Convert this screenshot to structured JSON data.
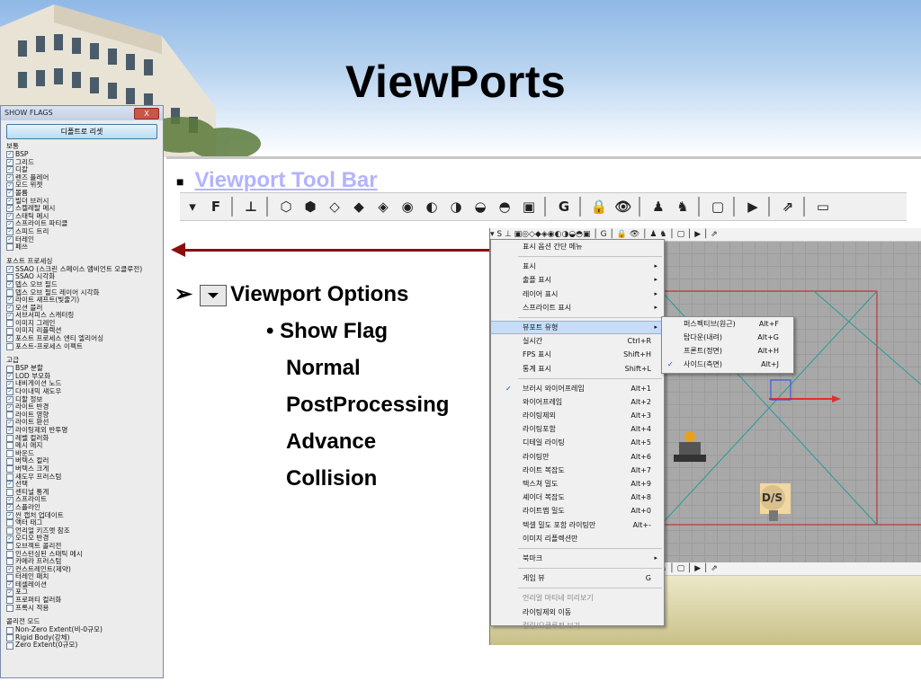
{
  "slide": {
    "title": "ViewPorts",
    "toolbar_heading": "Viewport Tool Bar",
    "options_heading": "Viewport Options",
    "show_flag": "Show Flag",
    "flag_types": [
      "Normal",
      "PostProcessing",
      "Advance",
      "Collision"
    ]
  },
  "colors": {
    "arrow": "#8b0f0f",
    "link": "#b3b3ff",
    "highlight": "#c7ddf7"
  },
  "show_flags_panel": {
    "title": "SHOW FLAGS",
    "close_label": "X",
    "reset_label": "디폴트로 리셋",
    "groups": [
      {
        "title": "보통",
        "items": [
          {
            "label": "BSP",
            "checked": true
          },
          {
            "label": "그리드",
            "checked": true
          },
          {
            "label": "디칼",
            "checked": true
          },
          {
            "label": "렌즈 플레어",
            "checked": true
          },
          {
            "label": "모드 위젯",
            "checked": true
          },
          {
            "label": "볼륨",
            "checked": true
          },
          {
            "label": "빌더 브러시",
            "checked": true
          },
          {
            "label": "스켈레탈 메시",
            "checked": true
          },
          {
            "label": "스태틱 메시",
            "checked": true
          },
          {
            "label": "스프라이트 파티클",
            "checked": true
          },
          {
            "label": "스피드 트리",
            "checked": true
          },
          {
            "label": "터레인",
            "checked": true
          },
          {
            "label": "페쓰",
            "checked": false
          }
        ]
      },
      {
        "title": "포스트 프로세싱",
        "items": [
          {
            "label": "SSAO (스크린 스페이스 앰비언트 오클루전)",
            "checked": true
          },
          {
            "label": "SSAO 시각화",
            "checked": false
          },
          {
            "label": "뎁스 오브 필드",
            "checked": true
          },
          {
            "label": "뎁스 오브 필드 레이어 시각화",
            "checked": false
          },
          {
            "label": "라이트 섀프트(빛줄기)",
            "checked": true
          },
          {
            "label": "모션 블러",
            "checked": true
          },
          {
            "label": "서브서피스 스캐터링",
            "checked": true
          },
          {
            "label": "이미지 그레인",
            "checked": false
          },
          {
            "label": "이미지 리플렉션",
            "checked": false
          },
          {
            "label": "포스트 프로세스 엔티 엘리어싱",
            "checked": true
          },
          {
            "label": "포스트-프로세스 이펙트",
            "checked": false
          }
        ]
      },
      {
        "title": "고급",
        "items": [
          {
            "label": "BSP 분할",
            "checked": false
          },
          {
            "label": "LOD 부모화",
            "checked": true
          },
          {
            "label": "내비게이션 노드",
            "checked": true
          },
          {
            "label": "다이내믹 섀도우",
            "checked": true
          },
          {
            "label": "디할 정보",
            "checked": true
          },
          {
            "label": "라이트 반경",
            "checked": true
          },
          {
            "label": "라이트 영향",
            "checked": false
          },
          {
            "label": "라이트 환선",
            "checked": true
          },
          {
            "label": "라이팅제외 반투명",
            "checked": true
          },
          {
            "label": "레벨 컬러화",
            "checked": false
          },
          {
            "label": "메시 에지",
            "checked": false
          },
          {
            "label": "바운드",
            "checked": false
          },
          {
            "label": "버텍스 컬러",
            "checked": false
          },
          {
            "label": "버텍스 크게",
            "checked": false
          },
          {
            "label": "섀도우 프러스텀",
            "checked": false
          },
          {
            "label": "선택",
            "checked": true
          },
          {
            "label": "센티널 통계",
            "checked": false
          },
          {
            "label": "스프라이트",
            "checked": true
          },
          {
            "label": "스플라인",
            "checked": true
          },
          {
            "label": "씬 캡처 업데이트",
            "checked": true
          },
          {
            "label": "액터 태그",
            "checked": false
          },
          {
            "label": "언리얼 키즈멧 참조",
            "checked": false
          },
          {
            "label": "오디오 반경",
            "checked": true
          },
          {
            "label": "오브젝트 콜리전",
            "checked": false
          },
          {
            "label": "인스턴싱된 스태틱 메시",
            "checked": false
          },
          {
            "label": "카메라 프러스텀",
            "checked": false
          },
          {
            "label": "컨스트레인트(제약)",
            "checked": true
          },
          {
            "label": "터레인 패치",
            "checked": false
          },
          {
            "label": "테셀레이션",
            "checked": true
          },
          {
            "label": "포그",
            "checked": true
          },
          {
            "label": "프로퍼티 컬러화",
            "checked": false
          },
          {
            "label": "프록시 적용",
            "checked": false
          }
        ]
      },
      {
        "title": "콜리전 모드",
        "items": [
          {
            "label": "Non-Zero Extent(비-0규모)",
            "checked": false
          },
          {
            "label": "Rigid Body(강체)",
            "checked": false
          },
          {
            "label": "Zero Extent(0규모)",
            "checked": false
          }
        ]
      }
    ]
  },
  "viewport_toolbar": {
    "buttons": [
      {
        "name": "viewport-options-dropdown",
        "glyph": "▾"
      },
      {
        "name": "f-button",
        "glyph": "F"
      },
      {
        "name": "lock-viewport",
        "glyph": "⊥"
      },
      {
        "name": "brush-wireframe",
        "glyph": "⬡"
      },
      {
        "name": "wireframe",
        "glyph": "⬢"
      },
      {
        "name": "unlit",
        "glyph": "◇"
      },
      {
        "name": "lit",
        "glyph": "◆"
      },
      {
        "name": "detail-lighting",
        "glyph": "◈"
      },
      {
        "name": "lighting-only",
        "glyph": "◉"
      },
      {
        "name": "light-complexity",
        "glyph": "◐"
      },
      {
        "name": "texture-density",
        "glyph": "◑"
      },
      {
        "name": "shader-complexity",
        "glyph": "◒"
      },
      {
        "name": "lightmap-density",
        "glyph": "◓"
      },
      {
        "name": "reflections",
        "glyph": "▣"
      },
      {
        "name": "game-view",
        "glyph": "G"
      },
      {
        "name": "lock-selection",
        "glyph": "🔒"
      },
      {
        "name": "realtime-preview",
        "glyph": "👁"
      },
      {
        "name": "actor-visible",
        "glyph": "♟"
      },
      {
        "name": "actor-hidden",
        "glyph": "♞"
      },
      {
        "name": "maximize-viewport",
        "glyph": "▢"
      },
      {
        "name": "play-in-viewport",
        "glyph": "▶"
      },
      {
        "name": "link-viewport",
        "glyph": "⇗"
      },
      {
        "name": "window-button",
        "glyph": "▭"
      }
    ]
  },
  "context_menu": {
    "items": [
      {
        "label": "표시 옵션 간단 메뉴",
        "shortcut": "",
        "arrow": false,
        "check": false,
        "hl": false,
        "dis": false
      },
      {
        "sep": true
      },
      {
        "label": "표시",
        "shortcut": "",
        "arrow": true,
        "check": false,
        "hl": false,
        "dis": false
      },
      {
        "label": "출플 표시",
        "shortcut": "",
        "arrow": true,
        "check": false,
        "hl": false,
        "dis": false
      },
      {
        "label": "레이어 표시",
        "shortcut": "",
        "arrow": true,
        "check": false,
        "hl": false,
        "dis": false
      },
      {
        "label": "스프라이트 표시",
        "shortcut": "",
        "arrow": true,
        "check": false,
        "hl": false,
        "dis": false
      },
      {
        "sep": true
      },
      {
        "label": "뷰포트 유형",
        "shortcut": "",
        "arrow": true,
        "check": false,
        "hl": true,
        "dis": false
      },
      {
        "label": "실시간",
        "shortcut": "Ctrl+R",
        "arrow": false,
        "check": false,
        "hl": false,
        "dis": false
      },
      {
        "label": "FPS 표시",
        "shortcut": "Shift+H",
        "arrow": false,
        "check": false,
        "hl": false,
        "dis": false
      },
      {
        "label": "통계 표시",
        "shortcut": "Shift+L",
        "arrow": false,
        "check": false,
        "hl": false,
        "dis": false
      },
      {
        "sep": true
      },
      {
        "label": "브러시 와이어프레임",
        "shortcut": "Alt+1",
        "arrow": false,
        "check": true,
        "hl": false,
        "dis": false
      },
      {
        "label": "와이어프레임",
        "shortcut": "Alt+2",
        "arrow": false,
        "check": false,
        "hl": false,
        "dis": false
      },
      {
        "label": "라이팅제외",
        "shortcut": "Alt+3",
        "arrow": false,
        "check": false,
        "hl": false,
        "dis": false
      },
      {
        "label": "라이팅포함",
        "shortcut": "Alt+4",
        "arrow": false,
        "check": false,
        "hl": false,
        "dis": false
      },
      {
        "label": "디테일 라이팅",
        "shortcut": "Alt+5",
        "arrow": false,
        "check": false,
        "hl": false,
        "dis": false
      },
      {
        "label": "라이팅만",
        "shortcut": "Alt+6",
        "arrow": false,
        "check": false,
        "hl": false,
        "dis": false
      },
      {
        "label": "라이트 복잡도",
        "shortcut": "Alt+7",
        "arrow": false,
        "check": false,
        "hl": false,
        "dis": false
      },
      {
        "label": "텍스쳐 밀도",
        "shortcut": "Alt+9",
        "arrow": false,
        "check": false,
        "hl": false,
        "dis": false
      },
      {
        "label": "셰이더 복잡도",
        "shortcut": "Alt+8",
        "arrow": false,
        "check": false,
        "hl": false,
        "dis": false
      },
      {
        "label": "라이트맵 밀도",
        "shortcut": "Alt+0",
        "arrow": false,
        "check": false,
        "hl": false,
        "dis": false
      },
      {
        "label": "텍셀 밀도 포함 라이팅만",
        "shortcut": "Alt+-",
        "arrow": false,
        "check": false,
        "hl": false,
        "dis": false
      },
      {
        "label": "이미지 리플렉션만",
        "shortcut": "",
        "arrow": false,
        "check": false,
        "hl": false,
        "dis": false
      },
      {
        "sep": true
      },
      {
        "label": "북마크",
        "shortcut": "",
        "arrow": true,
        "check": false,
        "hl": false,
        "dis": false
      },
      {
        "sep": true
      },
      {
        "label": "게임 뷰",
        "shortcut": "G",
        "arrow": false,
        "check": false,
        "hl": false,
        "dis": false
      },
      {
        "sep": true
      },
      {
        "label": "언리얼 마티네 미리보기",
        "shortcut": "",
        "arrow": false,
        "check": false,
        "hl": false,
        "dis": true
      },
      {
        "label": "라이팅제외 이동",
        "shortcut": "",
        "arrow": false,
        "check": false,
        "hl": false,
        "dis": false
      },
      {
        "label": "컬링/오클루전 보기",
        "shortcut": "",
        "arrow": false,
        "check": false,
        "hl": false,
        "dis": true
      }
    ]
  },
  "submenu": {
    "items": [
      {
        "label": "퍼스펙티브(원근)",
        "shortcut": "Alt+F",
        "check": false
      },
      {
        "label": "탑다운(내려)",
        "shortcut": "Alt+G",
        "check": false
      },
      {
        "label": "프론트(정면)",
        "shortcut": "Alt+H",
        "check": false
      },
      {
        "label": "사이드(측면)",
        "shortcut": "Alt+J",
        "check": true
      }
    ]
  },
  "screenshot_toolbar": {
    "text": "▾ S ⊥ ▣◎◇◆◈◉◐◑◒◓▣ │ G │ 🔒 👁 │ ♟ ♞ │ ▢ │ ▶ │ ⇗"
  },
  "badge_label": "D/S"
}
